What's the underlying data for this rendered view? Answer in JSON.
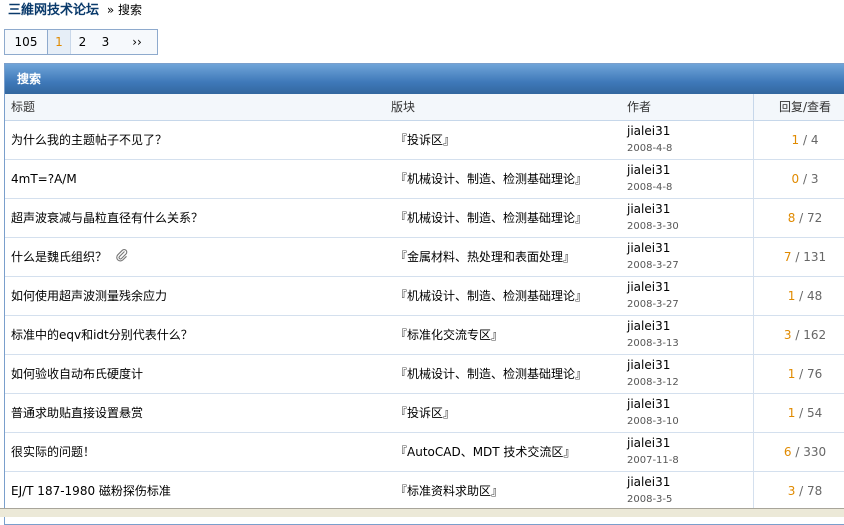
{
  "breadcrumb": {
    "site": "三維网技术论坛",
    "current": "» 搜索"
  },
  "pager": {
    "total": "105",
    "current": "1",
    "pages": [
      "2",
      "3"
    ],
    "next": "››"
  },
  "panel": {
    "title": "搜索"
  },
  "columns": {
    "title": "标题",
    "forum": "版块",
    "author": "作者",
    "stats": "回复/查看"
  },
  "rows": [
    {
      "title": "为什么我的主题帖子不见了？",
      "forum": "『投诉区』",
      "author": "jialei31",
      "date": "2008-4-8",
      "replies": "1",
      "views": "4",
      "attach": false
    },
    {
      "title": "4mT=?A/M",
      "forum": "『机械设计、制造、检测基础理论』",
      "author": "jialei31",
      "date": "2008-4-8",
      "replies": "0",
      "views": "3",
      "attach": false
    },
    {
      "title": "超声波衰减与晶粒直径有什么关系？",
      "forum": "『机械设计、制造、检测基础理论』",
      "author": "jialei31",
      "date": "2008-3-30",
      "replies": "8",
      "views": "72",
      "attach": false
    },
    {
      "title": "什么是魏氏组织？",
      "forum": "『金属材料、热处理和表面处理』",
      "author": "jialei31",
      "date": "2008-3-27",
      "replies": "7",
      "views": "131",
      "attach": true
    },
    {
      "title": "如何使用超声波测量残余应力",
      "forum": "『机械设计、制造、检测基础理论』",
      "author": "jialei31",
      "date": "2008-3-27",
      "replies": "1",
      "views": "48",
      "attach": false
    },
    {
      "title": "标准中的eqv和idt分别代表什么？",
      "forum": "『标准化交流专区』",
      "author": "jialei31",
      "date": "2008-3-13",
      "replies": "3",
      "views": "162",
      "attach": false
    },
    {
      "title": "如何验收自动布氏硬度计",
      "forum": "『机械设计、制造、检测基础理论』",
      "author": "jialei31",
      "date": "2008-3-12",
      "replies": "1",
      "views": "76",
      "attach": false
    },
    {
      "title": "普通求助贴直接设置悬赏",
      "forum": "『投诉区』",
      "author": "jialei31",
      "date": "2008-3-10",
      "replies": "1",
      "views": "54",
      "attach": false
    },
    {
      "title": "很实际的问题！",
      "forum": "『AutoCAD、MDT 技术交流区』",
      "author": "jialei31",
      "date": "2007-11-8",
      "replies": "6",
      "views": "330",
      "attach": false
    },
    {
      "title": "EJ/T 187-1980 磁粉探伤标准",
      "forum": "『标准资料求助区』",
      "author": "jialei31",
      "date": "2008-3-5",
      "replies": "3",
      "views": "78",
      "attach": false
    }
  ]
}
